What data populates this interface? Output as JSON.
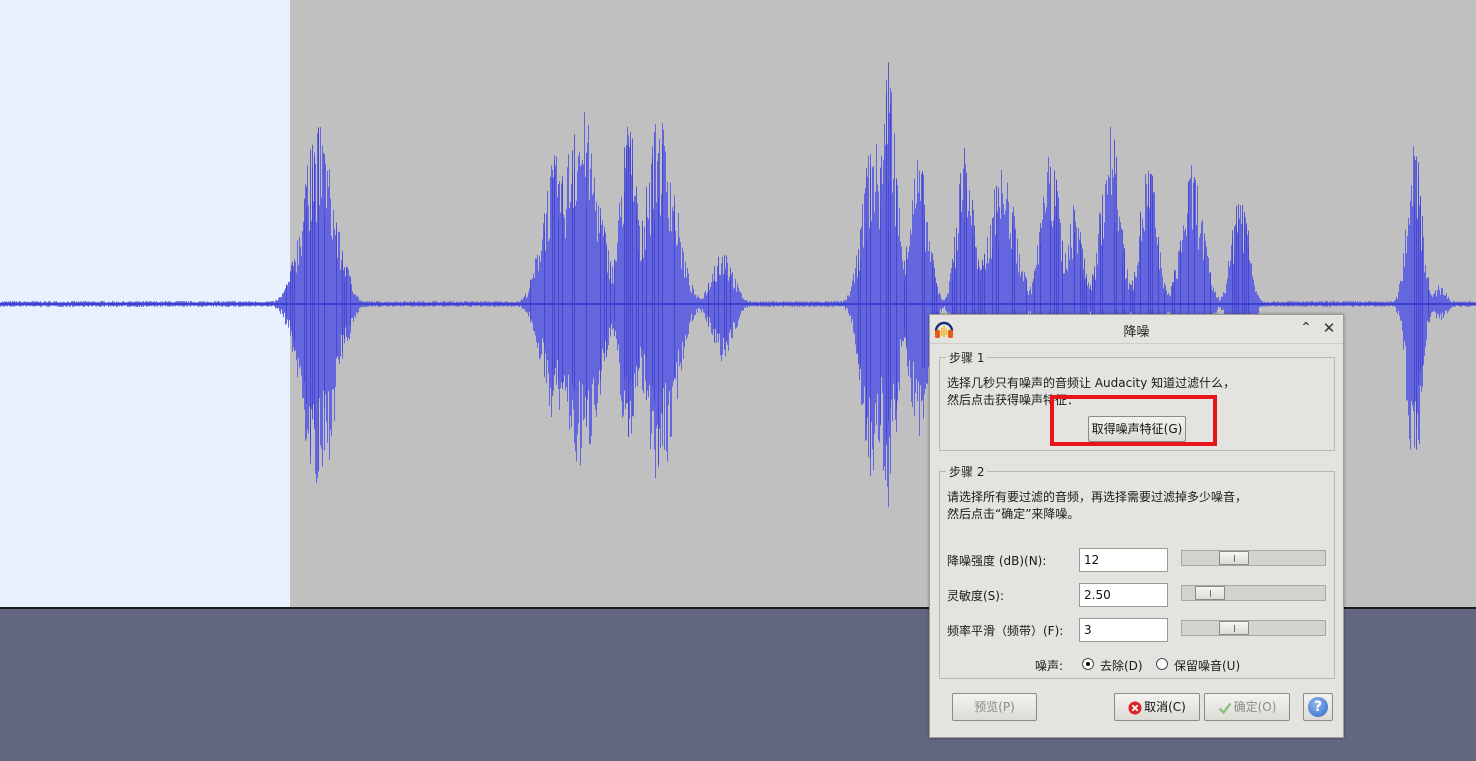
{
  "dialog": {
    "title": "降噪",
    "step1": {
      "legend": "步骤 1",
      "line1": "选择几秒只有噪声的音频让 Audacity 知道过滤什么，",
      "line2": "然后点击获得噪声特征：",
      "get_profile_label": "取得噪声特征(G)"
    },
    "step2": {
      "legend": "步骤 2",
      "line1": "请选择所有要过滤的音频，再选择需要过滤掉多少噪音，",
      "line2": "然后点击“确定”来降噪。",
      "noise_reduction": {
        "label": "降噪强度 (dB)(N):",
        "value": "12",
        "level_fraction": 0.33
      },
      "sensitivity": {
        "label": "灵敏度(S):",
        "value": "2.50",
        "level_fraction": 0.12
      },
      "freq_smoothing": {
        "label": "频率平滑（频带）(F):",
        "value": "3",
        "level_fraction": 0.33
      },
      "noise_label": "噪声:",
      "option_remove": "去除(D)",
      "option_keep": "保留噪音(U)",
      "selected_option": "remove"
    },
    "buttons": {
      "preview": "预览(P)",
      "cancel": "取消(C)",
      "ok": "确定(O)",
      "help": "?"
    }
  },
  "colors": {
    "waveform": "#6366dc",
    "waveform_line": "#3f3fcf",
    "track_bg": "#c0c0c0",
    "track_selected_bg": "#e9f1fe",
    "highlight": "#e8141b"
  },
  "icons": [
    "audacity-headphones-icon",
    "minimize-icon",
    "close-icon",
    "cancel-x-icon",
    "checkmark-icon",
    "help-icon"
  ]
}
